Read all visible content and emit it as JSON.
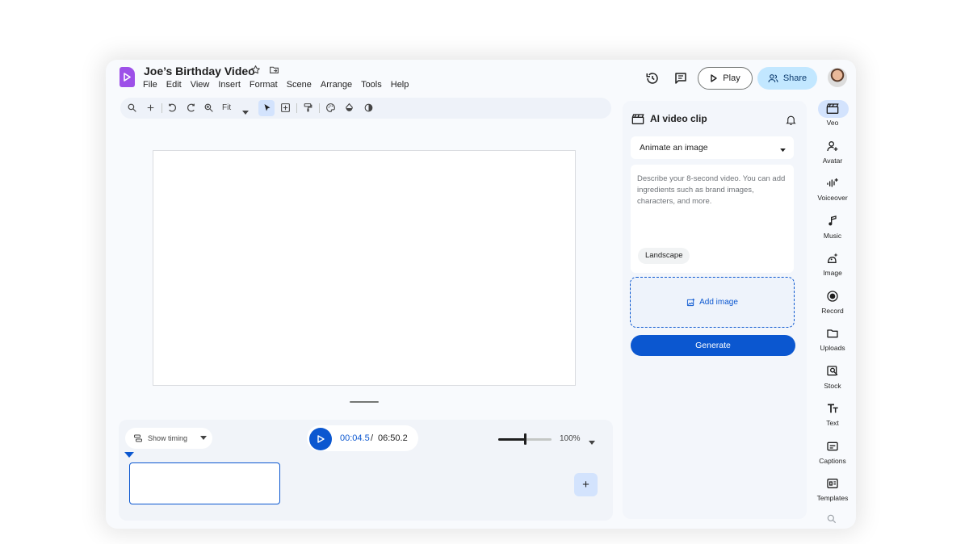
{
  "document": {
    "title": "Joe’s Birthday Video"
  },
  "menu": [
    "File",
    "Edit",
    "View",
    "Insert",
    "Format",
    "Scene",
    "Arrange",
    "Tools",
    "Help"
  ],
  "header": {
    "play_label": "Play",
    "share_label": "Share"
  },
  "toolbar": {
    "zoom_fit_label": "Fit"
  },
  "timeline": {
    "show_timing_label": "Show timing",
    "current_time": "00:04.5",
    "time_separator": "/",
    "total_time": "06:50.2",
    "zoom_label": "100%",
    "zoom_level": 0.5,
    "add_scene_label": "+"
  },
  "panel": {
    "title": "AI video clip",
    "mode_selected": "Animate an image",
    "prompt_placeholder": "Describe your 8-second video. You can add ingredients such as brand images, characters, and more.",
    "aspect_chip": "Landscape",
    "add_image_label": "Add image",
    "generate_label": "Generate"
  },
  "rail": [
    {
      "label": "Veo",
      "icon": "veo-clapper-icon"
    },
    {
      "label": "Avatar",
      "icon": "avatar-icon"
    },
    {
      "label": "Voiceover",
      "icon": "voiceover-icon"
    },
    {
      "label": "Music",
      "icon": "music-icon"
    },
    {
      "label": "Image",
      "icon": "image-sparkle-icon"
    },
    {
      "label": "Record",
      "icon": "record-icon"
    },
    {
      "label": "Uploads",
      "icon": "folder-icon"
    },
    {
      "label": "Stock",
      "icon": "stock-search-icon"
    },
    {
      "label": "Text",
      "icon": "text-icon"
    },
    {
      "label": "Captions",
      "icon": "captions-icon"
    },
    {
      "label": "Templates",
      "icon": "templates-icon"
    }
  ],
  "colors": {
    "accent": "#0b57d0",
    "share_bg": "#c2e7ff",
    "logo": "#9d50e8",
    "active_bg": "#d3e3fd"
  }
}
